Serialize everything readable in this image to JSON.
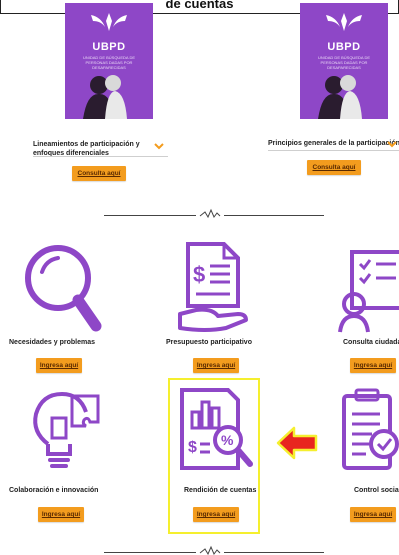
{
  "header": {
    "title": "de cuentas"
  },
  "documents": [
    {
      "brand": "UBPD",
      "subtitle": "UNIDAD DE BÚSQUEDA DE PERSONAS DADAS POR DESAPARECIDAS",
      "title": "Lineamientos de participación y enfoques diferenciales",
      "button": "Consulta aquí"
    },
    {
      "brand": "UBPD",
      "subtitle": "UNIDAD DE BÚSQUEDA DE PERSONAS DADAS POR DESAPARECIDAS",
      "title": "Principios generales de la participación",
      "button": "Consulta aquí"
    }
  ],
  "cards": [
    {
      "label": "Necesidades y problemas",
      "button": "Ingresa aquí",
      "icon": "magnifier-icon"
    },
    {
      "label": "Presupuesto participativo",
      "button": "Ingresa aquí",
      "icon": "budget-document-icon"
    },
    {
      "label": "Consulta ciudadana",
      "button": "Ingresa aquí",
      "icon": "consultation-icon"
    },
    {
      "label": "Colaboración e innovación",
      "button": "Ingresa aquí",
      "icon": "lightbulb-puzzle-icon"
    },
    {
      "label": "Rendición de cuentas",
      "button": "Ingresa aquí",
      "icon": "report-analysis-icon"
    },
    {
      "label": "Control social",
      "button": "Ingresa aquí",
      "icon": "clipboard-check-icon"
    }
  ],
  "colors": {
    "purple": "#8e47c7",
    "orange": "#f39c1e",
    "highlight": "#f5ef2e",
    "arrow": "#e8251f"
  }
}
